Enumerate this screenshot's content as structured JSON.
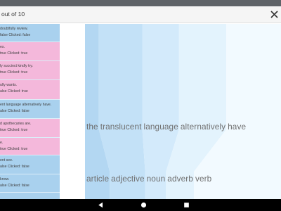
{
  "header": {
    "title": "out of 10"
  },
  "sidebar": {
    "items": [
      {
        "color": "blue",
        "text": "doubtfully review.",
        "status": "false  Clicked: false"
      },
      {
        "color": "pink",
        "text": "es.",
        "status": "true  Clicked: true"
      },
      {
        "color": "pink",
        "text": "ly succinct kindly try.",
        "status": "true  Clicked: true"
      },
      {
        "color": "pink",
        "text": "ully wants.",
        "status": "alse  Clicked: true"
      },
      {
        "color": "blue",
        "text": "ent language alternatively have.",
        "status": "alse  Clicked: false"
      },
      {
        "color": "pink",
        "text": "d apothecaries are.",
        "status": "true  Clicked: true"
      },
      {
        "color": "pink",
        "text": "e.",
        "status": "true  Clicked: true"
      },
      {
        "color": "blue",
        "text": "ent see.",
        "status": "alse  Clicked: false"
      },
      {
        "color": "blue",
        "text": "know.",
        "status": "alse  Clicked: false"
      },
      {
        "color": "blue",
        "text": "",
        "status": "false  Clicked: false"
      }
    ]
  },
  "canvas": {
    "sentence": [
      "the",
      "translucent",
      "language",
      "alternatively",
      "have"
    ],
    "pos_labels": [
      "article",
      "adjective",
      "noun",
      "adverb",
      "verb"
    ],
    "band_colors": [
      "#b3d7f2",
      "#c3e1f7",
      "#d3eafb",
      "#e3f3fd",
      "#f2faff"
    ]
  },
  "navbar": {
    "back_icon": "back-triangle-icon",
    "home_icon": "home-circle-icon",
    "recents_icon": "recents-square-icon"
  }
}
